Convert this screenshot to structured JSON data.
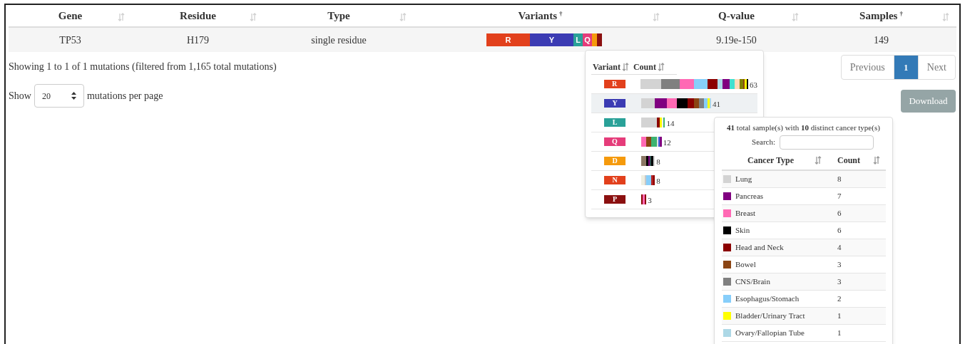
{
  "table": {
    "columns": [
      {
        "label": "Gene"
      },
      {
        "label": "Residue"
      },
      {
        "label": "Type"
      },
      {
        "label": "Variants",
        "note": "†"
      },
      {
        "label": "Q-value"
      },
      {
        "label": "Samples",
        "note": "†"
      }
    ],
    "rows": [
      {
        "gene": "TP53",
        "residue": "H179",
        "type": "single residue",
        "variants_bar": [
          {
            "label": "R",
            "color": "#e2401c"
          },
          {
            "label": "Y",
            "color": "#3b3bb3"
          },
          {
            "label": "L",
            "color": "#2aa198"
          },
          {
            "label": "Q",
            "color": "#e53c7a"
          },
          {
            "color": "#f59a0c"
          },
          {
            "color": "#8b1010"
          }
        ],
        "q_value": "9.19e-150",
        "samples": "149"
      }
    ]
  },
  "info": "Showing 1 to 1 of 1 mutations (filtered from 1,165 total mutations)",
  "page_size": {
    "prefix": "Show",
    "value": "20",
    "suffix": "mutations per page"
  },
  "pagination": [
    {
      "label": "Previous",
      "selected": false
    },
    {
      "label": "1",
      "selected": true
    },
    {
      "label": "Next",
      "selected": false
    }
  ],
  "download_button": {
    "label": "Download",
    "disabled": true
  },
  "variant_popup": {
    "columns": [
      "Variant",
      "Count"
    ],
    "rows": [
      {
        "variant": "R",
        "color": "#e2401c",
        "selected": false,
        "count": "63",
        "samples": [
          {
            "color": "#d3d3d3"
          },
          {
            "color": "#d3d3d3"
          },
          {
            "color": "#d3d3d3"
          },
          {
            "color": "#d3d3d3"
          },
          {
            "color": "#d3d3d3"
          },
          {
            "color": "#d3d3d3"
          },
          {
            "color": "#d3d3d3"
          },
          {
            "color": "#d3d3d3"
          },
          {
            "color": "#d3d3d3"
          },
          {
            "color": "#d3d3d3"
          },
          {
            "color": "#d3d3d3"
          },
          {
            "color": "#d3d3d3"
          },
          {
            "color": "#808080"
          },
          {
            "color": "#808080"
          },
          {
            "color": "#808080"
          },
          {
            "color": "#808080"
          },
          {
            "color": "#808080"
          },
          {
            "color": "#808080"
          },
          {
            "color": "#808080"
          },
          {
            "color": "#808080"
          },
          {
            "color": "#808080"
          },
          {
            "color": "#808080"
          },
          {
            "color": "#808080"
          },
          {
            "color": "#ff69b4"
          },
          {
            "color": "#ff69b4"
          },
          {
            "color": "#ff69b4"
          },
          {
            "color": "#ff69b4"
          },
          {
            "color": "#ff69b4"
          },
          {
            "color": "#ff69b4"
          },
          {
            "color": "#ff69b4"
          },
          {
            "color": "#ff69b4"
          },
          {
            "color": "#87cefa"
          },
          {
            "color": "#87cefa"
          },
          {
            "color": "#87cefa"
          },
          {
            "color": "#87cefa"
          },
          {
            "color": "#87cefa"
          },
          {
            "color": "#87cefa"
          },
          {
            "color": "#87cefa"
          },
          {
            "color": "#87cefa"
          },
          {
            "color": "#8b0000"
          },
          {
            "color": "#8b0000"
          },
          {
            "color": "#8b0000"
          },
          {
            "color": "#8b0000"
          },
          {
            "color": "#8b0000"
          },
          {
            "color": "#8b0000"
          },
          {
            "color": "#add8e6"
          },
          {
            "color": "#add8e6"
          },
          {
            "color": "#add8e6"
          },
          {
            "color": "#800080"
          },
          {
            "color": "#800080"
          },
          {
            "color": "#800080"
          },
          {
            "color": "#800080"
          },
          {
            "color": "#40e0d0"
          },
          {
            "color": "#40e0d0"
          },
          {
            "color": "#40e0d0"
          },
          {
            "color": "#ffdab9"
          },
          {
            "color": "#ffdab9"
          },
          {
            "color": "#ffdab9"
          },
          {
            "color": "#808000"
          },
          {
            "color": "#808000"
          },
          {
            "color": "#8b4513"
          },
          {
            "color": "#ffff00"
          },
          {
            "color": "#000000"
          }
        ]
      },
      {
        "variant": "Y",
        "color": "#3b3bb3",
        "selected": true,
        "count": "41",
        "samples": [
          {
            "color": "#d3d3d3"
          },
          {
            "color": "#d3d3d3"
          },
          {
            "color": "#d3d3d3"
          },
          {
            "color": "#d3d3d3"
          },
          {
            "color": "#d3d3d3"
          },
          {
            "color": "#d3d3d3"
          },
          {
            "color": "#d3d3d3"
          },
          {
            "color": "#d3d3d3"
          },
          {
            "color": "#800080"
          },
          {
            "color": "#800080"
          },
          {
            "color": "#800080"
          },
          {
            "color": "#800080"
          },
          {
            "color": "#800080"
          },
          {
            "color": "#800080"
          },
          {
            "color": "#800080"
          },
          {
            "color": "#ff69b4"
          },
          {
            "color": "#ff69b4"
          },
          {
            "color": "#ff69b4"
          },
          {
            "color": "#ff69b4"
          },
          {
            "color": "#ff69b4"
          },
          {
            "color": "#ff69b4"
          },
          {
            "color": "#000000"
          },
          {
            "color": "#000000"
          },
          {
            "color": "#000000"
          },
          {
            "color": "#000000"
          },
          {
            "color": "#000000"
          },
          {
            "color": "#000000"
          },
          {
            "color": "#8b0000"
          },
          {
            "color": "#8b0000"
          },
          {
            "color": "#8b0000"
          },
          {
            "color": "#8b0000"
          },
          {
            "color": "#8b4513"
          },
          {
            "color": "#8b4513"
          },
          {
            "color": "#8b4513"
          },
          {
            "color": "#808080"
          },
          {
            "color": "#808080"
          },
          {
            "color": "#808080"
          },
          {
            "color": "#87cefa"
          },
          {
            "color": "#87cefa"
          },
          {
            "color": "#ffff00"
          },
          {
            "color": "#add8e6"
          }
        ]
      },
      {
        "variant": "L",
        "color": "#2aa198",
        "selected": false,
        "count": "14",
        "samples": [
          {
            "color": "#d3d3d3"
          },
          {
            "color": "#d3d3d3"
          },
          {
            "color": "#d3d3d3"
          },
          {
            "color": "#d3d3d3"
          },
          {
            "color": "#d3d3d3"
          },
          {
            "color": "#d3d3d3"
          },
          {
            "color": "#d3d3d3"
          },
          {
            "color": "#d3d3d3"
          },
          {
            "color": "#d3d3d3"
          },
          {
            "color": "#8b0000"
          },
          {
            "color": "#8b0000"
          },
          {
            "color": "#ffff00"
          },
          {
            "color": "#f0f0f0"
          },
          {
            "color": "#3cb371"
          }
        ]
      },
      {
        "variant": "Q",
        "color": "#e53c7a",
        "selected": false,
        "count": "12",
        "samples": [
          {
            "color": "#ff69b4"
          },
          {
            "color": "#ff69b4"
          },
          {
            "color": "#ff69b4"
          },
          {
            "color": "#8b4513"
          },
          {
            "color": "#8b4513"
          },
          {
            "color": "#8b4513"
          },
          {
            "color": "#3cb371"
          },
          {
            "color": "#3cb371"
          },
          {
            "color": "#3cb371"
          },
          {
            "color": "#e0e0e0"
          },
          {
            "color": "#4169e1"
          },
          {
            "color": "#800080"
          }
        ]
      },
      {
        "variant": "D",
        "color": "#f59a0c",
        "selected": false,
        "count": "8",
        "samples": [
          {
            "color": "#8b7765"
          },
          {
            "color": "#8b7765"
          },
          {
            "color": "#8b7765"
          },
          {
            "color": "#000000"
          },
          {
            "color": "#800080"
          },
          {
            "color": "#2f4f4f"
          },
          {
            "color": "#000000"
          },
          {
            "color": "#d3d3d3"
          }
        ]
      },
      {
        "variant": "N",
        "color": "#e2401c",
        "selected": false,
        "count": "8",
        "samples": [
          {
            "color": "#eeeee0"
          },
          {
            "color": "#eeeee0"
          },
          {
            "color": "#c8c8c8"
          },
          {
            "color": "#87cefa"
          },
          {
            "color": "#87cefa"
          },
          {
            "color": "#87cefa"
          },
          {
            "color": "#b22222"
          },
          {
            "color": "#8b0000"
          }
        ]
      },
      {
        "variant": "P",
        "color": "#8b1010",
        "selected": false,
        "count": "3",
        "samples": [
          {
            "color": "#8b0000"
          },
          {
            "color": "#ff69b4"
          },
          {
            "color": "#8b0000"
          }
        ]
      }
    ]
  },
  "cancer_popup": {
    "summary": "**41** total sample(s) with **10** distinct cancer type(s)",
    "search_label": "Search:",
    "columns": [
      "Cancer Type",
      "Count"
    ],
    "rows": [
      {
        "name": "Lung",
        "color": "#d3d3d3",
        "count": "8"
      },
      {
        "name": "Pancreas",
        "color": "#800080",
        "count": "7"
      },
      {
        "name": "Breast",
        "color": "#ff69b4",
        "count": "6"
      },
      {
        "name": "Skin",
        "color": "#000000",
        "count": "6"
      },
      {
        "name": "Head and Neck",
        "color": "#8b0000",
        "count": "4"
      },
      {
        "name": "Bowel",
        "color": "#8b4513",
        "count": "3"
      },
      {
        "name": "CNS/Brain",
        "color": "#808080",
        "count": "3"
      },
      {
        "name": "Esophagus/Stomach",
        "color": "#87cefa",
        "count": "2"
      },
      {
        "name": "Bladder/Urinary Tract",
        "color": "#ffff00",
        "count": "1"
      },
      {
        "name": "Ovary/Fallopian Tube",
        "color": "#add8e6",
        "count": "1"
      }
    ]
  }
}
